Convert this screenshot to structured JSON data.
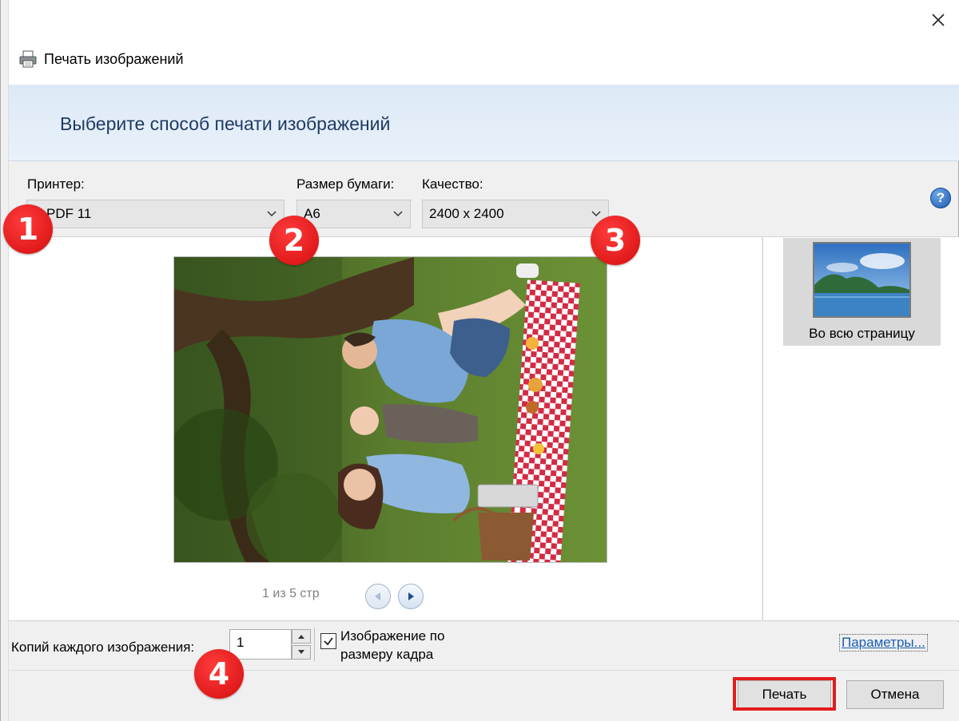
{
  "window": {
    "title": "Печать изображений",
    "banner_heading": "Выберите способ печати изображений",
    "close_glyph": "✕"
  },
  "printer": {
    "label": "Принтер:",
    "value": "PDF 11"
  },
  "paper_size": {
    "label": "Размер бумаги:",
    "value": "A6"
  },
  "quality": {
    "label": "Качество:",
    "value": "2400 x 2400"
  },
  "help": {
    "glyph": "?"
  },
  "preview": {
    "page_counter": "1 из 5 стр"
  },
  "layouts": {
    "selected_caption": "Во всю страницу"
  },
  "copies": {
    "label": "Копий каждого изображения:",
    "value": "1"
  },
  "fit_to_frame": {
    "label": "Изображение по размеру кадра",
    "checked": true
  },
  "options_link": "Параметры...",
  "buttons": {
    "print": "Печать",
    "cancel": "Отмена"
  },
  "markers": [
    "1",
    "2",
    "3",
    "4"
  ],
  "colors": {
    "accent_red": "#e31c1c",
    "banner_blue": "#dce9f6",
    "heading_text": "#1f3b63",
    "link_blue": "#1a5fb4"
  }
}
